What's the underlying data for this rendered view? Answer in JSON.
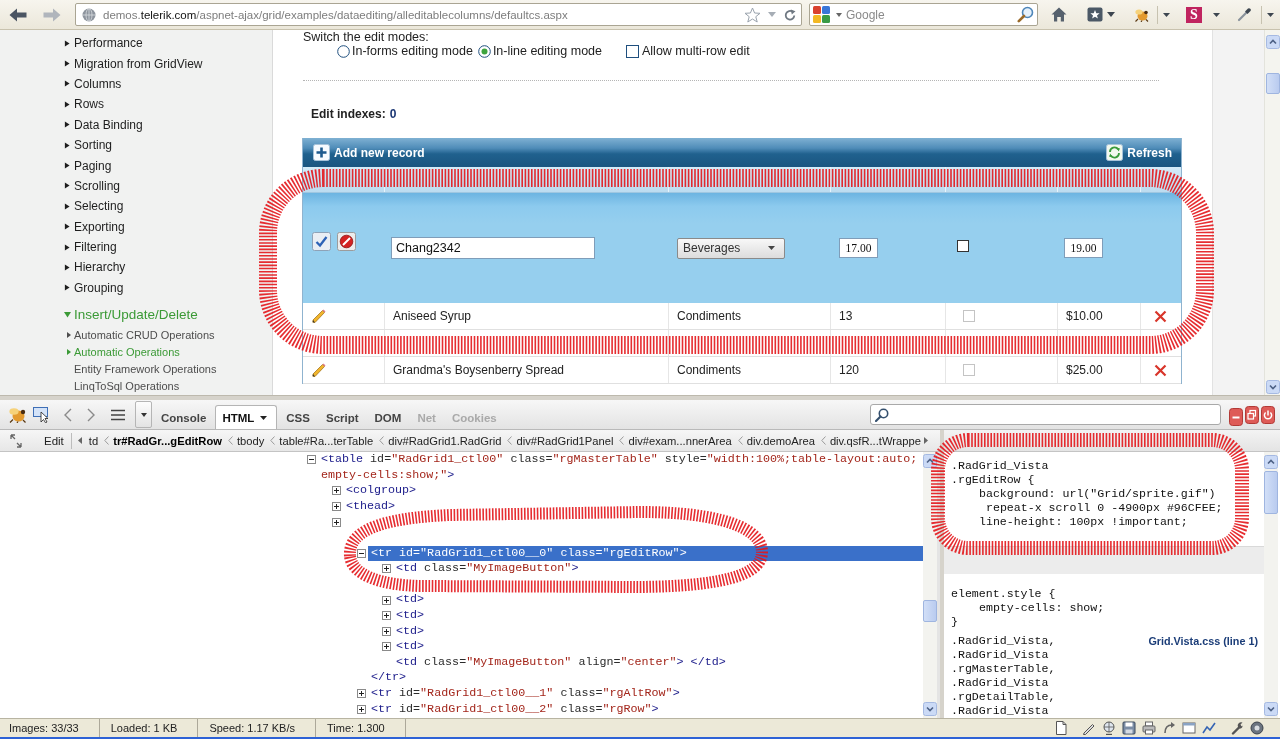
{
  "browser": {
    "url": {
      "prefix": "demos.",
      "domain": "telerik.com",
      "path": "/aspnet-ajax/grid/examples/dataediting/alleditablecolumns/defaultcs.aspx"
    },
    "search": {
      "placeholder": "Google"
    },
    "extension_letter": "S"
  },
  "nav": {
    "items": [
      {
        "label": "Performance",
        "expanded": false,
        "selected": false
      },
      {
        "label": "Migration from GridView",
        "expanded": false,
        "selected": false
      },
      {
        "label": "Columns",
        "expanded": false,
        "selected": false
      },
      {
        "label": "Rows",
        "expanded": false,
        "selected": false
      },
      {
        "label": "Data Binding",
        "expanded": false,
        "selected": false
      },
      {
        "label": "Sorting",
        "expanded": false,
        "selected": false
      },
      {
        "label": "Paging",
        "expanded": false,
        "selected": false
      },
      {
        "label": "Scrolling",
        "expanded": false,
        "selected": false
      },
      {
        "label": "Selecting",
        "expanded": false,
        "selected": false
      },
      {
        "label": "Exporting",
        "expanded": false,
        "selected": false
      },
      {
        "label": "Filtering",
        "expanded": false,
        "selected": false
      },
      {
        "label": "Hierarchy",
        "expanded": false,
        "selected": false
      },
      {
        "label": "Grouping",
        "expanded": false,
        "selected": false
      },
      {
        "label": "Insert/Update/Delete",
        "expanded": true,
        "selected": false,
        "children": [
          {
            "label": "Automatic CRUD Operations",
            "expanded": false,
            "selected": false
          },
          {
            "label": "Automatic Operations",
            "expanded": false,
            "selected": true
          },
          {
            "label": "Entity Framework Operations",
            "selected": false
          },
          {
            "label": "LinqToSql Operations",
            "selected": false
          }
        ]
      }
    ]
  },
  "demo": {
    "heading": "Switch the edit modes:",
    "edit_modes": [
      {
        "label": "In-forms editing mode",
        "selected": false
      },
      {
        "label": "In-line editing mode",
        "selected": true
      }
    ],
    "multi_row_edit": {
      "label": "Allow multi-row edit",
      "checked": false
    },
    "edit_indexes": {
      "label": "Edit indexes:",
      "value": "0"
    }
  },
  "grid": {
    "add_label": "Add new record",
    "refresh_label": "Refresh",
    "edit_row": {
      "product_name": "Chang2342",
      "category": "Beverages",
      "units_in_stock": "17.00",
      "discontinued": false,
      "unit_price": "19.00"
    },
    "rows": [
      {
        "kind": "data",
        "product_name": "Aniseed Syrup",
        "category": "Condiments",
        "units_in_stock": "13",
        "discontinued": false,
        "unit_price": "$10.00"
      },
      {
        "kind": "covered"
      },
      {
        "kind": "data",
        "product_name": "Grandma's Boysenberry Spread",
        "category": "Condiments",
        "units_in_stock": "120",
        "discontinued": false,
        "unit_price": "$25.00"
      }
    ]
  },
  "firebug": {
    "tabs": [
      {
        "label": "Console",
        "selected": false,
        "disabled": false
      },
      {
        "label": "HTML",
        "selected": true,
        "disabled": false
      },
      {
        "label": "CSS",
        "selected": false,
        "disabled": false
      },
      {
        "label": "Script",
        "selected": false,
        "disabled": false
      },
      {
        "label": "DOM",
        "selected": false,
        "disabled": false
      },
      {
        "label": "Net",
        "selected": false,
        "disabled": true
      },
      {
        "label": "Cookies",
        "selected": false,
        "disabled": true
      }
    ],
    "breadcrumb": {
      "edit_label": "Edit",
      "items": [
        {
          "label": "td",
          "selected": false
        },
        {
          "label": "tr#RadGr...gEditRow",
          "selected": true
        },
        {
          "label": "tbody",
          "selected": false
        },
        {
          "label": "table#Ra...terTable",
          "selected": false
        },
        {
          "label": "div#RadGrid1.RadGrid",
          "selected": false
        },
        {
          "label": "div#RadGrid1Panel",
          "selected": false
        },
        {
          "label": "div#exam...nnerArea",
          "selected": false
        },
        {
          "label": "div.demoArea",
          "selected": false
        },
        {
          "label": "div.qsfR...tWrappe",
          "selected": false
        }
      ]
    },
    "html_tree": [
      {
        "kind": "element",
        "expanded": true,
        "selected": false,
        "lines": [
          [
            {
              "kind": "tag",
              "text": "<table"
            },
            {
              "kind": "attr",
              "text": " id="
            },
            {
              "kind": "value",
              "text": "\"RadGrid1_ctl00\""
            },
            {
              "kind": "attr",
              "text": " class="
            },
            {
              "kind": "value",
              "text": "\"rgMasterTable\""
            },
            {
              "kind": "attr",
              "text": " style="
            },
            {
              "kind": "value",
              "text": "\"width:100%;table-layout:auto;"
            }
          ],
          [
            {
              "kind": "value",
              "text": "empty-cells:show;\""
            },
            {
              "kind": "tag",
              "text": ">"
            }
          ]
        ],
        "children": [
          {
            "kind": "element",
            "expanded": false,
            "selected": false,
            "lines": [
              [
                {
                  "kind": "tag",
                  "text": "<colgroup>"
                }
              ]
            ]
          },
          {
            "kind": "element",
            "expanded": false,
            "selected": false,
            "lines": [
              [
                {
                  "kind": "tag",
                  "text": "<thead>"
                }
              ]
            ]
          },
          {
            "kind": "covered",
            "expanded": false
          },
          {
            "kind": "covered",
            "children": [
              {
                "kind": "element",
                "expanded": true,
                "selected": true,
                "lines": [
                  [
                    {
                      "kind": "tag",
                      "text": "<tr"
                    },
                    {
                      "kind": "attr",
                      "text": " id="
                    },
                    {
                      "kind": "value",
                      "text": "\"RadGrid1_ctl00__0\""
                    },
                    {
                      "kind": "attr",
                      "text": " class="
                    },
                    {
                      "kind": "value",
                      "text": "\"rgEditRow\""
                    },
                    {
                      "kind": "tag",
                      "text": ">"
                    }
                  ]
                ],
                "children": [
                  {
                    "kind": "element",
                    "expanded": false,
                    "selected": false,
                    "lines": [
                      [
                        {
                          "kind": "tag",
                          "text": "<td"
                        },
                        {
                          "kind": "attr",
                          "text": " class="
                        },
                        {
                          "kind": "value",
                          "text": "\"MyImageButton\""
                        },
                        {
                          "kind": "tag",
                          "text": ">"
                        }
                      ]
                    ]
                  },
                  {
                    "kind": "covered"
                  },
                  {
                    "kind": "element",
                    "expanded": false,
                    "selected": false,
                    "lines": [
                      [
                        {
                          "kind": "tag",
                          "text": "<td>"
                        }
                      ]
                    ]
                  },
                  {
                    "kind": "element",
                    "expanded": false,
                    "selected": false,
                    "lines": [
                      [
                        {
                          "kind": "tag",
                          "text": "<td>"
                        }
                      ]
                    ]
                  },
                  {
                    "kind": "element",
                    "expanded": false,
                    "selected": false,
                    "lines": [
                      [
                        {
                          "kind": "tag",
                          "text": "<td>"
                        }
                      ]
                    ]
                  },
                  {
                    "kind": "element",
                    "expanded": false,
                    "selected": false,
                    "lines": [
                      [
                        {
                          "kind": "tag",
                          "text": "<td>"
                        }
                      ]
                    ]
                  },
                  {
                    "kind": "element",
                    "selected": false,
                    "lines": [
                      [
                        {
                          "kind": "tag",
                          "text": "<td"
                        },
                        {
                          "kind": "attr",
                          "text": " class="
                        },
                        {
                          "kind": "value",
                          "text": "\"MyImageButton\""
                        },
                        {
                          "kind": "attr",
                          "text": " align="
                        },
                        {
                          "kind": "value",
                          "text": "\"center\""
                        },
                        {
                          "kind": "tag",
                          "text": "> </td>"
                        }
                      ]
                    ]
                  }
                ],
                "closing": [
                  [
                    {
                      "kind": "tag",
                      "text": "</tr>"
                    }
                  ]
                ]
              },
              {
                "kind": "element",
                "expanded": false,
                "selected": false,
                "lines": [
                  [
                    {
                      "kind": "tag",
                      "text": "<tr"
                    },
                    {
                      "kind": "attr",
                      "text": " id="
                    },
                    {
                      "kind": "value",
                      "text": "\"RadGrid1_ctl00__1\""
                    },
                    {
                      "kind": "attr",
                      "text": " class="
                    },
                    {
                      "kind": "value",
                      "text": "\"rgAltRow\""
                    },
                    {
                      "kind": "tag",
                      "text": ">"
                    }
                  ]
                ]
              },
              {
                "kind": "element",
                "expanded": false,
                "selected": false,
                "lines": [
                  [
                    {
                      "kind": "tag",
                      "text": "<tr"
                    },
                    {
                      "kind": "attr",
                      "text": " id="
                    },
                    {
                      "kind": "value",
                      "text": "\"RadGrid1_ctl00__2\""
                    },
                    {
                      "kind": "attr",
                      "text": " class="
                    },
                    {
                      "kind": "value",
                      "text": "\"rgRow\""
                    },
                    {
                      "kind": "tag",
                      "text": ">"
                    }
                  ]
                ]
              }
            ]
          }
        ]
      }
    ],
    "style_rules": [
      {
        "kind": "rule",
        "selector": [
          ".RadGrid_Vista",
          ".rgEditRow {"
        ],
        "declarations": [
          {
            "lines": [
              "background: url(\"Grid/sprite.gif\")",
              "repeat-x scroll 0 -4900px #96CFEE;"
            ]
          },
          {
            "lines": [
              "line-height: 100px !important;"
            ]
          }
        ]
      },
      {
        "kind": "inherited"
      },
      {
        "kind": "rule",
        "selector": [
          "element.style {"
        ],
        "declarations": [
          {
            "lines": [
              "empty-cells: show;"
            ]
          }
        ],
        "closing": "}"
      },
      {
        "kind": "rule",
        "source": "Grid.Vista.css (line 1)",
        "selector": [
          ".RadGrid_Vista,",
          ".RadGrid_Vista",
          ".rgMasterTable,",
          ".RadGrid_Vista",
          ".rgDetailTable,",
          ".RadGrid_Vista"
        ]
      }
    ]
  },
  "status_bar": {
    "fields": [
      "Images: 33/33",
      "Loaded: 1 KB",
      "Speed: 1.17 KB/s",
      "Time: 1.300"
    ]
  }
}
